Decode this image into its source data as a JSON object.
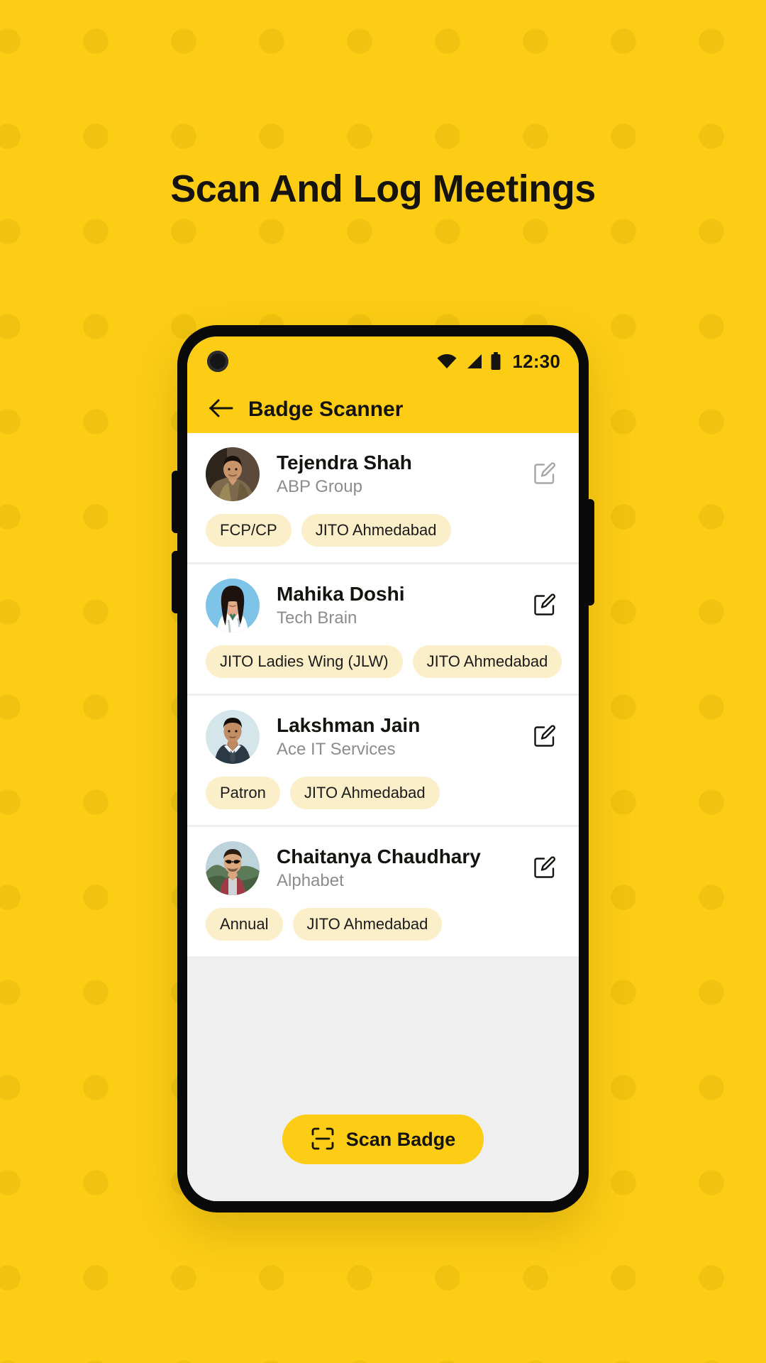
{
  "headline": "Scan And Log Meetings",
  "theme": {
    "brand_yellow": "#FCCD14",
    "dot_pattern": "#E2B60A",
    "screen_bg": "#EFEFEF",
    "card_bg": "#FFFFFF",
    "tag_bg": "#FBEFC9",
    "text_dark": "#15130F",
    "text_muted": "#8C8C8C",
    "frame_black": "#0A0A0A"
  },
  "phone": {
    "status_bar": {
      "time": "12:30",
      "icons": [
        "wifi-icon",
        "cellular-signal-icon",
        "battery-icon"
      ],
      "camera": "front-camera-punch-hole"
    },
    "app_bar": {
      "back_icon": "arrow-left-icon",
      "title": "Badge Scanner"
    },
    "contacts": [
      {
        "name": "Tejendra Shah",
        "company": "ABP Group",
        "tags": [
          "FCP/CP",
          "JITO Ahmedabad"
        ],
        "edit_icon": "edit-pencil-icon",
        "avatar_colors": [
          "#6b5a4a",
          "#3a2f26",
          "#d8a882",
          "#8a7a5e"
        ]
      },
      {
        "name": "Mahika Doshi",
        "company": "Tech Brain",
        "tags": [
          "JITO Ladies Wing (JLW)",
          "JITO Ahmedabad"
        ],
        "edit_icon": "edit-pencil-icon",
        "avatar_colors": [
          "#78c0e8",
          "#2b1a14",
          "#e8b896",
          "#ffffff"
        ]
      },
      {
        "name": "Lakshman Jain",
        "company": "Ace IT Services",
        "tags": [
          "Patron",
          "JITO Ahmedabad"
        ],
        "edit_icon": "edit-pencil-icon",
        "avatar_colors": [
          "#cfe3e8",
          "#1d1410",
          "#c99a72",
          "#2c3a44"
        ]
      },
      {
        "name": "Chaitanya Chaudhary",
        "company": "Alphabet",
        "tags": [
          "Annual",
          "JITO Ahmedabad"
        ],
        "edit_icon": "edit-pencil-icon",
        "avatar_colors": [
          "#b9cfd4",
          "#4c6d58",
          "#d9a784",
          "#9d3b44"
        ]
      }
    ],
    "scan_button": {
      "label": "Scan Badge",
      "icon": "scan-frame-icon"
    }
  }
}
